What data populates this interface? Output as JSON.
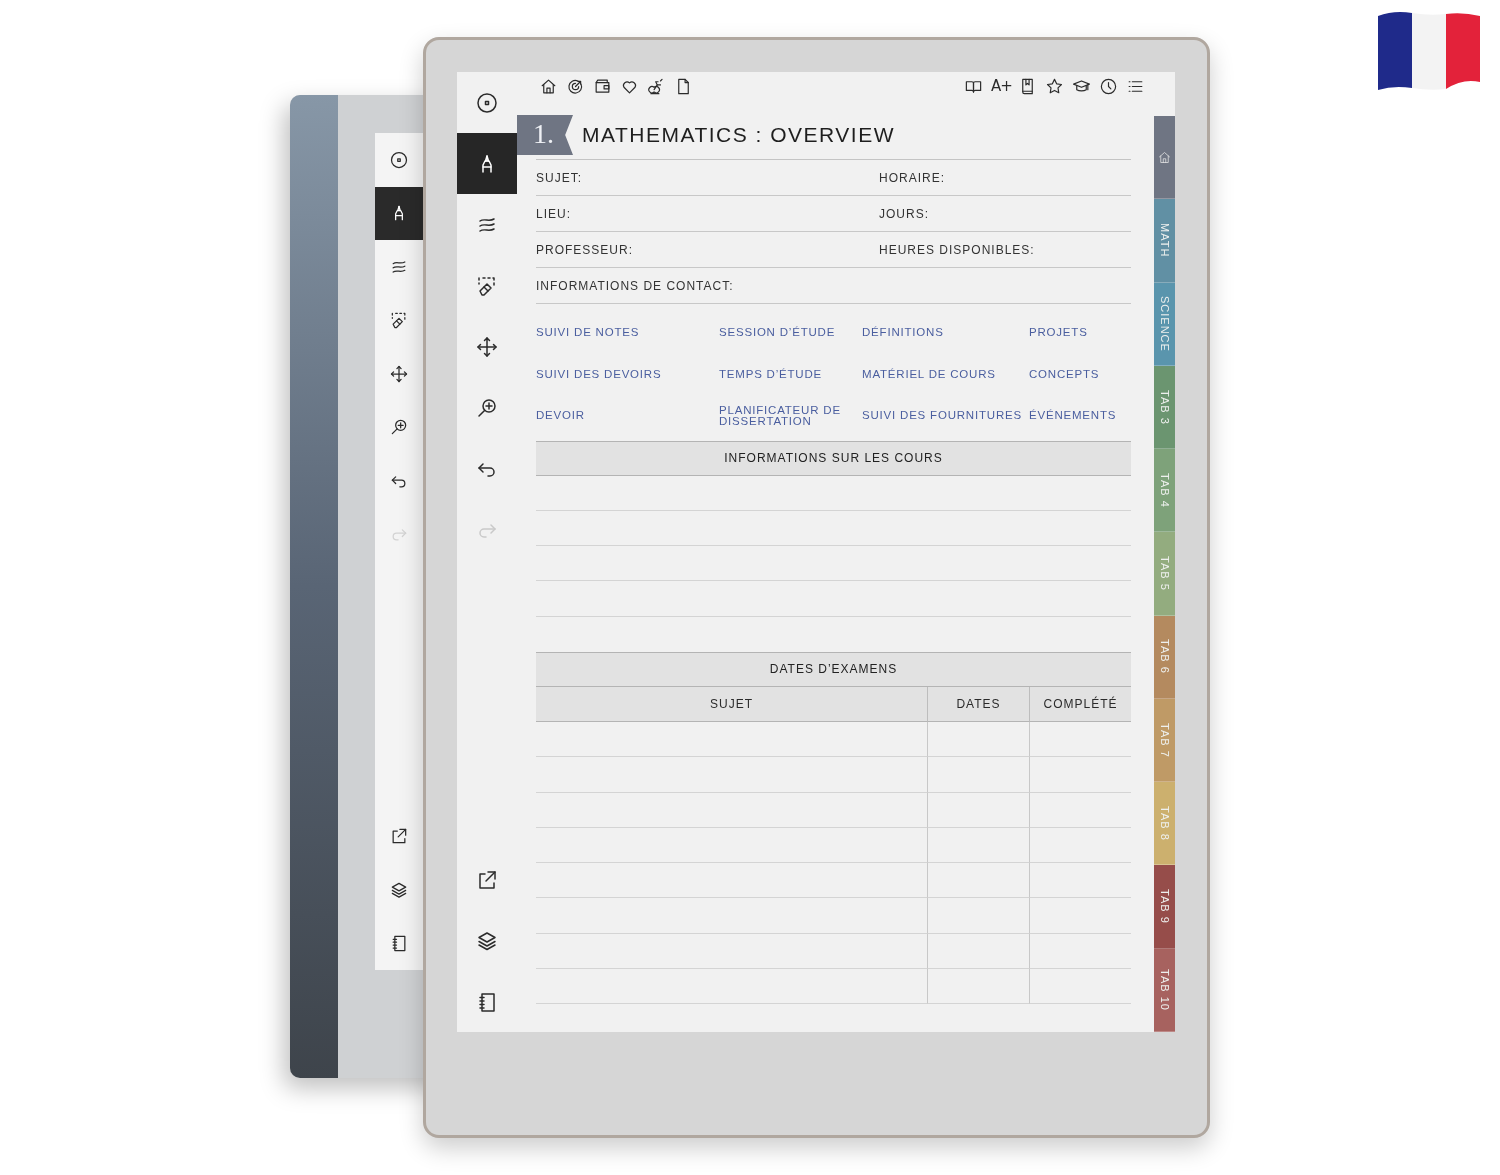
{
  "back_device": {
    "tools": [
      {
        "kind": "target",
        "selected": false,
        "disabled": false
      },
      {
        "kind": "pen",
        "selected": true,
        "disabled": false
      },
      {
        "kind": "strokes",
        "selected": false,
        "disabled": false
      },
      {
        "kind": "eraser",
        "selected": false,
        "disabled": false
      },
      {
        "kind": "move",
        "selected": false,
        "disabled": false
      },
      {
        "kind": "zoom",
        "selected": false,
        "disabled": false
      },
      {
        "kind": "undo",
        "selected": false,
        "disabled": false
      },
      {
        "kind": "redo",
        "selected": false,
        "disabled": true
      }
    ],
    "bottom_tools": [
      {
        "kind": "export"
      },
      {
        "kind": "layers"
      },
      {
        "kind": "notebook"
      }
    ]
  },
  "toolbar": {
    "tools": [
      {
        "kind": "target",
        "selected": false,
        "disabled": false
      },
      {
        "kind": "pen",
        "selected": true,
        "disabled": false
      },
      {
        "kind": "strokes",
        "selected": false,
        "disabled": false
      },
      {
        "kind": "eraser",
        "selected": false,
        "disabled": false
      },
      {
        "kind": "move",
        "selected": false,
        "disabled": false
      },
      {
        "kind": "zoom",
        "selected": false,
        "disabled": false
      },
      {
        "kind": "undo",
        "selected": false,
        "disabled": false
      },
      {
        "kind": "redo",
        "selected": false,
        "disabled": true
      }
    ],
    "bottom_tools": [
      {
        "kind": "export"
      },
      {
        "kind": "layers"
      },
      {
        "kind": "notebook"
      }
    ]
  },
  "top_bar": {
    "left_icons": [
      {
        "kind": "home"
      },
      {
        "kind": "gauge"
      },
      {
        "kind": "wallet"
      },
      {
        "kind": "heart"
      },
      {
        "kind": "bike"
      },
      {
        "kind": "page"
      }
    ],
    "right_icons": [
      {
        "kind": "book"
      },
      {
        "kind": "text",
        "label": "A+"
      },
      {
        "kind": "bookmark"
      },
      {
        "kind": "star"
      },
      {
        "kind": "cap"
      },
      {
        "kind": "clock"
      },
      {
        "kind": "list"
      }
    ]
  },
  "page": {
    "number": "1.",
    "title": "MATHEMATICS : OVERVIEW",
    "fields": [
      {
        "label": "SUJET:"
      },
      {
        "label": "HORAIRE:"
      },
      {
        "label": "LIEU:"
      },
      {
        "label": "JOURS:"
      },
      {
        "label": "PROFESSEUR:"
      },
      {
        "label": "HEURES DISPONIBLES:"
      },
      {
        "label": "INFORMATIONS DE CONTACT:"
      }
    ],
    "links": [
      "SUIVI DE NOTES",
      "SESSION D’ÉTUDE",
      "DÉFINITIONS",
      "PROJETS",
      "SUIVI DES DEVOIRS",
      "TEMPS D’ÉTUDE",
      "MATÉRIEL DE COURS",
      "CONCEPTS",
      "DEVOIR",
      "PLANIFICATEUR DE DISSERTATION",
      "SUIVI DES FOURNITURES",
      "ÉVÉNEMENTS"
    ],
    "course_info": {
      "title": "INFORMATIONS SUR LES COURS"
    },
    "exam_dates": {
      "title": "DATES D’EXAMENS",
      "columns": [
        "SUJET",
        "DATES",
        "COMPLÉTÉ"
      ]
    }
  },
  "side_tabs": [
    {
      "kind": "home",
      "color": "#6f7583"
    },
    {
      "kind": "label",
      "label": "MATH",
      "color": "#6190a4"
    },
    {
      "kind": "label",
      "label": "SCIENCE",
      "color": "#5a95ad"
    },
    {
      "kind": "label",
      "label": "TAB 3",
      "color": "#6b9570"
    },
    {
      "kind": "label",
      "label": "TAB 4",
      "color": "#7ea27a"
    },
    {
      "kind": "label",
      "label": "TAB 5",
      "color": "#93ac7f"
    },
    {
      "kind": "label",
      "label": "TAB 6",
      "color": "#b48a5f"
    },
    {
      "kind": "label",
      "label": "TAB 7",
      "color": "#bf9a66"
    },
    {
      "kind": "label",
      "label": "TAB 8",
      "color": "#ccb06e"
    },
    {
      "kind": "label",
      "label": "TAB 9",
      "color": "#964d4a"
    },
    {
      "kind": "label",
      "label": "TAB 10",
      "color": "#a7625f"
    }
  ]
}
